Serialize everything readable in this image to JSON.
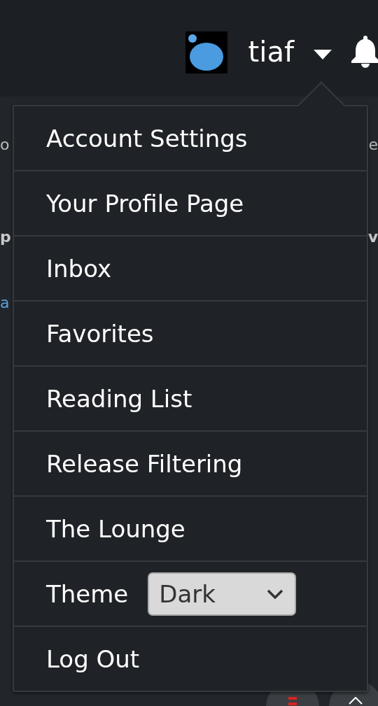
{
  "header": {
    "username": "tiaf"
  },
  "background": {
    "row_1": {
      "left": "o",
      "right": "e"
    },
    "heading": {
      "left": "p",
      "right": "v"
    },
    "link": "a"
  },
  "menu": {
    "items": [
      {
        "kind": "link",
        "label": "Account Settings"
      },
      {
        "kind": "link",
        "label": "Your Profile Page"
      },
      {
        "kind": "link",
        "label": "Inbox"
      },
      {
        "kind": "link",
        "label": "Favorites"
      },
      {
        "kind": "link",
        "label": "Reading List"
      },
      {
        "kind": "link",
        "label": "Release Filtering"
      },
      {
        "kind": "link",
        "label": "The Lounge"
      },
      {
        "kind": "select",
        "label": "Theme",
        "value": "Dark"
      },
      {
        "kind": "link",
        "label": "Log Out"
      }
    ]
  }
}
